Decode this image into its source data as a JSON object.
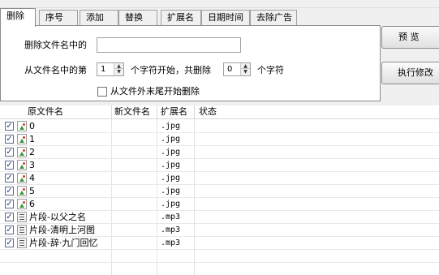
{
  "tabs": [
    {
      "label": "删除",
      "active": true
    },
    {
      "label": "序号",
      "active": false
    },
    {
      "label": "添加",
      "active": false
    },
    {
      "label": "替换",
      "active": false
    },
    {
      "label": "扩展名",
      "active": false
    },
    {
      "label": "日期时间",
      "active": false
    },
    {
      "label": "去除广告",
      "active": false
    }
  ],
  "delete_panel": {
    "delete_in_name_label": "删除文件名中的",
    "delete_in_name_value": "",
    "from_position_label": "从文件名中的第",
    "start_value": "1",
    "start_suffix_label": "个字符开始，共删除",
    "count_value": "0",
    "count_suffix_label": "个字符",
    "from_end_label": "从文件外末尾开始删除",
    "from_end_checked": false
  },
  "buttons": {
    "preview": "预  览",
    "execute": "执行修改"
  },
  "table": {
    "columns": [
      "原文件名",
      "新文件名",
      "扩展名",
      "状态"
    ],
    "rows": [
      {
        "checked": true,
        "icon": "image-file-icon",
        "name": "0",
        "new_name": "",
        "ext": ".jpg",
        "status": ""
      },
      {
        "checked": true,
        "icon": "image-file-icon",
        "name": "1",
        "new_name": "",
        "ext": ".jpg",
        "status": ""
      },
      {
        "checked": true,
        "icon": "image-file-icon",
        "name": "2",
        "new_name": "",
        "ext": ".jpg",
        "status": ""
      },
      {
        "checked": true,
        "icon": "image-file-icon",
        "name": "3",
        "new_name": "",
        "ext": ".jpg",
        "status": ""
      },
      {
        "checked": true,
        "icon": "image-file-icon",
        "name": "4",
        "new_name": "",
        "ext": ".jpg",
        "status": ""
      },
      {
        "checked": true,
        "icon": "image-file-icon",
        "name": "5",
        "new_name": "",
        "ext": ".jpg",
        "status": ""
      },
      {
        "checked": true,
        "icon": "image-file-icon",
        "name": "6",
        "new_name": "",
        "ext": ".jpg",
        "status": ""
      },
      {
        "checked": true,
        "icon": "audio-file-icon",
        "name": "片段-以父之名",
        "new_name": "",
        "ext": ".mp3",
        "status": ""
      },
      {
        "checked": true,
        "icon": "audio-file-icon",
        "name": "片段-清明上河图",
        "new_name": "",
        "ext": ".mp3",
        "status": ""
      },
      {
        "checked": true,
        "icon": "audio-file-icon",
        "name": "片段-辞·九门回忆",
        "new_name": "",
        "ext": ".mp3",
        "status": ""
      }
    ]
  }
}
